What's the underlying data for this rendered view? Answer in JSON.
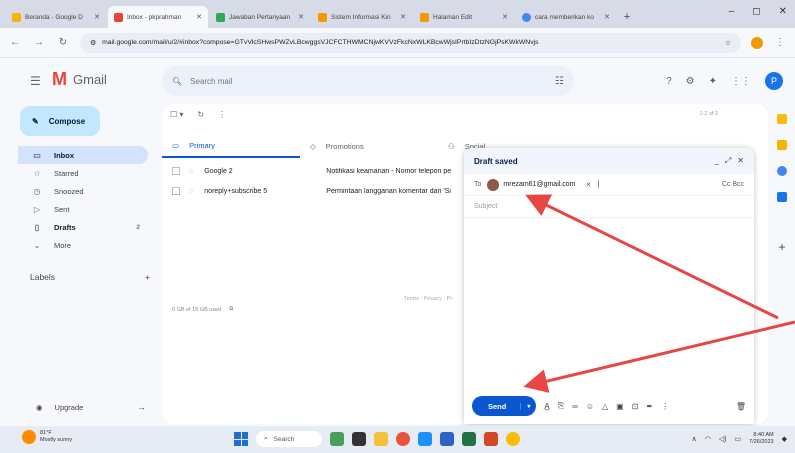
{
  "browser": {
    "tabs": [
      {
        "label": "Beranda - Google D",
        "color": "#f4b400"
      },
      {
        "label": "Inbox - pkprahman",
        "color": "#ea4335"
      },
      {
        "label": "Jawaban Pertanyaan",
        "color": "#34a853"
      },
      {
        "label": "Sistem Informasi Kin",
        "color": "#f29900"
      },
      {
        "label": "Halaman Edit",
        "color": "#f29900"
      },
      {
        "label": "cara memberikan ko",
        "color": "#4285f4"
      }
    ],
    "url": "mail.google.com/mail/u/2/#inbox?compose=GTvVlcSHwsPWZvLBcwggsVJCFCTHWMCNjwKVVzFkcNxWLKBcwWjsIPrtbIzDtzNGjPsKWkWNvjs"
  },
  "gmail": {
    "logo_text": "Gmail",
    "search_placeholder": "Search mail",
    "avatar_letter": "P",
    "compose_label": "Compose",
    "nav": [
      {
        "label": "Inbox",
        "icon": "inbox-icon",
        "count": ""
      },
      {
        "label": "Starred",
        "icon": "star-icon",
        "count": ""
      },
      {
        "label": "Snoozed",
        "icon": "clock-icon",
        "count": ""
      },
      {
        "label": "Sent",
        "icon": "send-icon",
        "count": ""
      },
      {
        "label": "Drafts",
        "icon": "draft-icon",
        "count": "2"
      },
      {
        "label": "More",
        "icon": "chevron-down-icon",
        "count": ""
      }
    ],
    "labels_heading": "Labels",
    "upgrade_label": "Upgrade",
    "pager": "1-2 of 2",
    "tabs": [
      {
        "label": "Primary"
      },
      {
        "label": "Promotions"
      },
      {
        "label": "Social"
      }
    ],
    "emails": [
      {
        "sender": "Google 2",
        "subject": "Notifikasi keamanan - Nomor telepon pe"
      },
      {
        "sender": "noreply+subscribe 5",
        "subject": "Permintaan langganan komentar dari 'Si"
      }
    ],
    "storage": "0 GB of 15 GB used",
    "footer": "Terms · Privacy · Pr"
  },
  "compose_window": {
    "title": "Draft saved",
    "to_label": "To",
    "recipient": "mrezam61@gmail.com",
    "cc_bcc": "Cc Bcc",
    "subject_placeholder": "Subject",
    "send_label": "Send"
  },
  "taskbar": {
    "weather_temp": "81°F",
    "weather_desc": "Mostly sunny",
    "search_label": "Search",
    "time": "8:40 AM",
    "date": "7/26/2023"
  }
}
